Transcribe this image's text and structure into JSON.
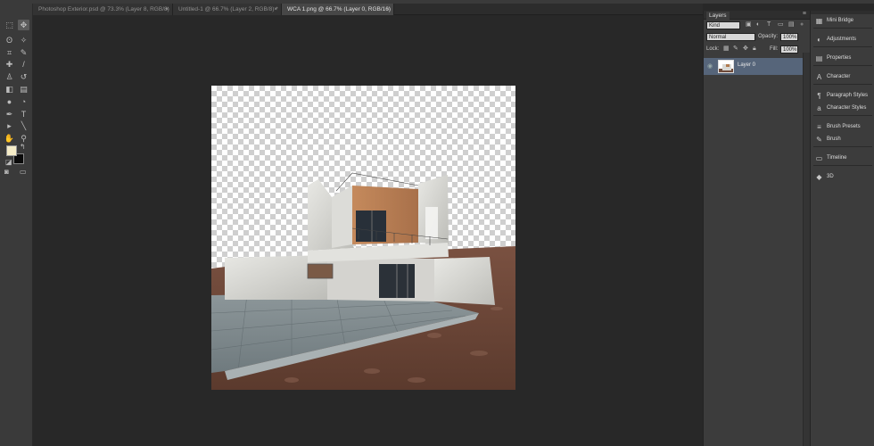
{
  "tabs": [
    {
      "label": "Photoshop Exterior.psd @ 73.3% (Layer 8, RGB/8)",
      "close": "×",
      "active": false
    },
    {
      "label": "Untitled-1 @ 66.7% (Layer 2, RGB/8) *",
      "close": "×",
      "active": false
    },
    {
      "label": "WCA 1.png @ 66.7% (Layer 0, RGB/16)",
      "close": "×",
      "active": true
    }
  ],
  "tools": [
    {
      "name": "marquee-tool-icon",
      "glyph": "⬚"
    },
    {
      "name": "move-tool-icon",
      "glyph": "✥"
    },
    {
      "name": "lasso-tool-icon",
      "glyph": "ʘ"
    },
    {
      "name": "magic-wand-tool-icon",
      "glyph": "✧"
    },
    {
      "name": "crop-tool-icon",
      "glyph": "⌗"
    },
    {
      "name": "eyedropper-tool-icon",
      "glyph": "✎"
    },
    {
      "name": "healing-brush-tool-icon",
      "glyph": "✚"
    },
    {
      "name": "brush-tool-icon",
      "glyph": "/"
    },
    {
      "name": "clone-stamp-tool-icon",
      "glyph": "♙"
    },
    {
      "name": "history-brush-tool-icon",
      "glyph": "↺"
    },
    {
      "name": "eraser-tool-icon",
      "glyph": "◧"
    },
    {
      "name": "gradient-tool-icon",
      "glyph": "▤"
    },
    {
      "name": "blur-tool-icon",
      "glyph": "●"
    },
    {
      "name": "dodge-tool-icon",
      "glyph": "◔"
    },
    {
      "name": "pen-tool-icon",
      "glyph": "✒"
    },
    {
      "name": "type-tool-icon",
      "glyph": "T"
    },
    {
      "name": "path-selection-tool-icon",
      "glyph": "▸"
    },
    {
      "name": "line-tool-icon",
      "glyph": "╲"
    },
    {
      "name": "hand-tool-icon",
      "glyph": "✋"
    },
    {
      "name": "zoom-tool-icon",
      "glyph": "⚲"
    }
  ],
  "layers_panel": {
    "title": "Layers",
    "menu_icon": "menu-icon",
    "kind_label": "Kind",
    "blend_mode": "Normal",
    "opacity_label": "Opacity:",
    "opacity_value": "100%",
    "lock_label": "Lock:",
    "fill_label": "Fill:",
    "fill_value": "100%",
    "layers": [
      {
        "name": "Layer 0",
        "selected": true
      }
    ]
  },
  "side_panels": [
    {
      "label": "Mini Bridge",
      "icon": "mini-bridge-icon",
      "glyph": "▦"
    },
    {
      "label": "Adjustments",
      "icon": "adjustments-icon",
      "glyph": "◐"
    },
    {
      "label": "Properties",
      "icon": "properties-icon",
      "glyph": "▤"
    },
    {
      "label": "Character",
      "icon": "character-icon",
      "glyph": "A"
    },
    {
      "label": "Paragraph Styles",
      "icon": "paragraph-styles-icon",
      "glyph": "¶"
    },
    {
      "label": "Character Styles",
      "icon": "character-styles-icon",
      "glyph": "a"
    },
    {
      "label": "Brush Presets",
      "icon": "brush-presets-icon",
      "glyph": "≡"
    },
    {
      "label": "Brush",
      "icon": "brush-icon",
      "glyph": "✎"
    },
    {
      "label": "Timeline",
      "icon": "timeline-icon",
      "glyph": "▭"
    },
    {
      "label": "3D",
      "icon": "3d-icon",
      "glyph": "◆"
    }
  ],
  "colors": {
    "foreground": "#f5ecc7",
    "background": "#0a0a0a",
    "selected_layer": "#56657a"
  }
}
